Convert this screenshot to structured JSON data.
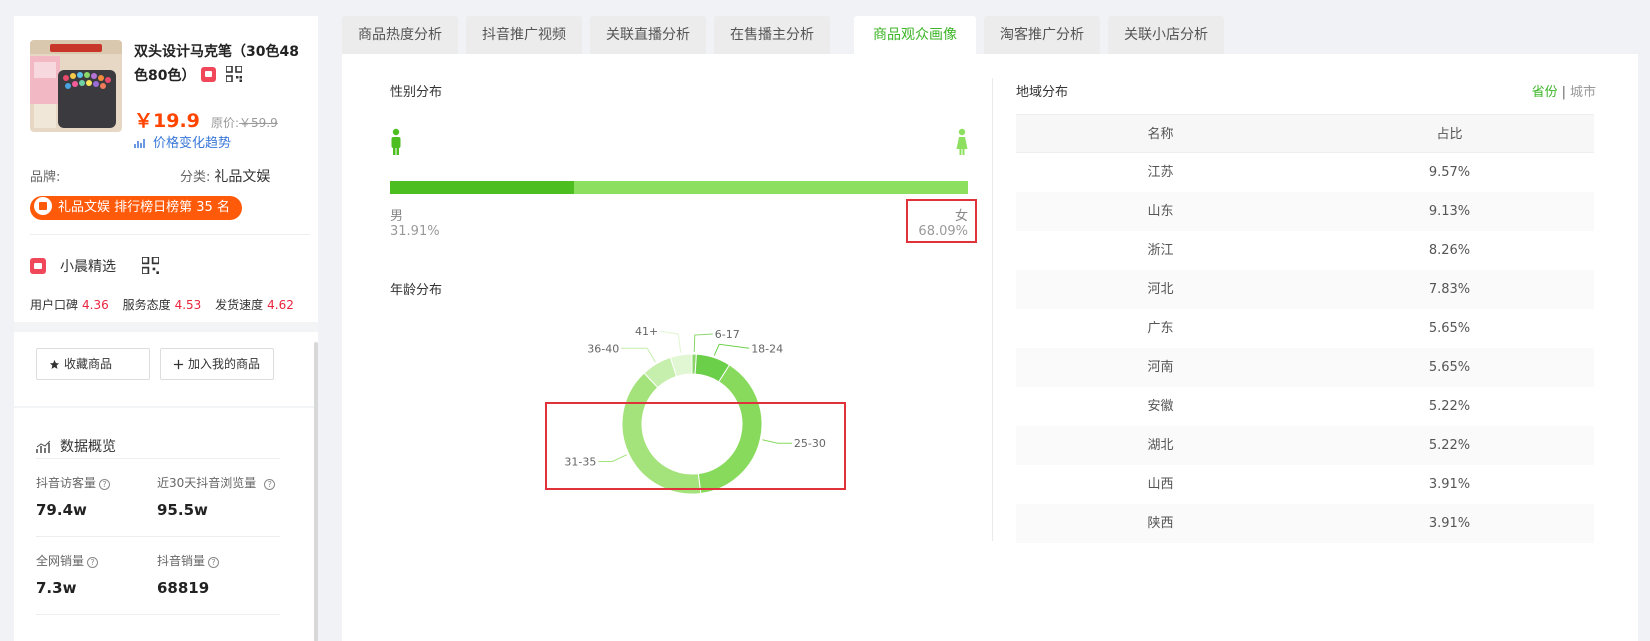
{
  "product": {
    "title": "双头设计马克笔（30色48色80色）",
    "price": "￥19.9",
    "original_label": "原价:",
    "original_price": "￥59.9",
    "price_trend_link": "价格变化趋势",
    "brand_label": "品牌:",
    "category_label": "分类:",
    "category_value": "礼品文娱",
    "rank_badge": "礼品文娱 排行榜日榜第 35 名"
  },
  "shop": {
    "name": "小晨精选",
    "scores": [
      {
        "label": "用户口碑",
        "value": "4.36"
      },
      {
        "label": "服务态度",
        "value": "4.53"
      },
      {
        "label": "发货速度",
        "value": "4.62"
      }
    ]
  },
  "actions": {
    "favorite": "收藏商品",
    "add_mine": "加入我的商品"
  },
  "overview": {
    "title": "数据概览",
    "stats": [
      {
        "label": "抖音访客量",
        "value": "79.4w"
      },
      {
        "label": "近30天抖音浏览量",
        "value": "95.5w"
      },
      {
        "label": "全网销量",
        "value": "7.3w"
      },
      {
        "label": "抖音销量",
        "value": "68819"
      }
    ]
  },
  "tabs": [
    "商品热度分析",
    "抖音推广视频",
    "关联直播分析",
    "在售播主分析",
    "商品观众画像",
    "淘客推广分析",
    "关联小店分析"
  ],
  "active_tab": 4,
  "gender": {
    "title": "性别分布",
    "male_label": "男",
    "male_value": "31.91%",
    "male_fraction": 0.3191,
    "female_label": "女",
    "female_value": "68.09%"
  },
  "age": {
    "title": "年龄分布"
  },
  "chart_data": {
    "type": "pie",
    "variant": "donut",
    "categories": [
      "6-17",
      "18-24",
      "25-30",
      "31-35",
      "36-40",
      "41+"
    ],
    "values": [
      1,
      8,
      39,
      40,
      7,
      5
    ],
    "colors": [
      "#8ad668",
      "#6ccf4a",
      "#88da5c",
      "#a4e27c",
      "#c6eeac",
      "#e1f6d2"
    ]
  },
  "region": {
    "title": "地域分布",
    "toggle_province": "省份",
    "toggle_city": "城市",
    "col_name": "名称",
    "col_share": "占比",
    "rows": [
      {
        "name": "江苏",
        "share": "9.57%"
      },
      {
        "name": "山东",
        "share": "9.13%"
      },
      {
        "name": "浙江",
        "share": "8.26%"
      },
      {
        "name": "河北",
        "share": "7.83%"
      },
      {
        "name": "广东",
        "share": "5.65%"
      },
      {
        "name": "河南",
        "share": "5.65%"
      },
      {
        "name": "安徽",
        "share": "5.22%"
      },
      {
        "name": "湖北",
        "share": "5.22%"
      },
      {
        "name": "山西",
        "share": "3.91%"
      },
      {
        "name": "陕西",
        "share": "3.91%"
      }
    ]
  },
  "colors": {
    "accent": "#3cb526",
    "price": "#ff4400",
    "rank": "#ff5a0a",
    "score": "#e8253d",
    "highlight": "#e0323a"
  }
}
